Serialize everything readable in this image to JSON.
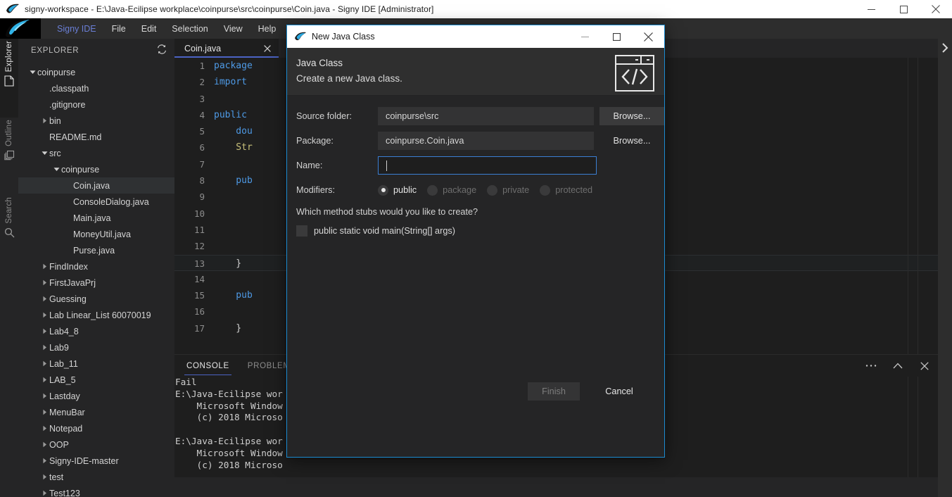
{
  "window": {
    "title": "signy-workspace - E:\\Java-Ecilipse workplace\\coinpurse\\src\\coinpurse\\Coin.java - Signy IDE [Administrator]",
    "app_icon": "signy-logo-icon",
    "minimize_icon": "minimize-icon",
    "maximize_icon": "maximize-icon",
    "close_icon": "close-icon"
  },
  "menubar": {
    "items": [
      {
        "label": "Signy IDE",
        "accent": true
      },
      {
        "label": "File",
        "accent": false
      },
      {
        "label": "Edit",
        "accent": false
      },
      {
        "label": "Selection",
        "accent": false
      },
      {
        "label": "View",
        "accent": false
      },
      {
        "label": "Help",
        "accent": false
      }
    ]
  },
  "activitybar": {
    "tabs": [
      {
        "label": "Explorer",
        "icon": "file-icon",
        "active": true
      },
      {
        "label": "Outline",
        "icon": "layers-icon",
        "active": false
      },
      {
        "label": "Search",
        "icon": "search-icon",
        "active": false
      }
    ]
  },
  "sidebar": {
    "title": "EXPLORER",
    "refresh_icon": "refresh-icon",
    "tree": [
      {
        "label": "coinpurse",
        "indent": 0,
        "twisty": "down",
        "selected": false
      },
      {
        "label": ".classpath",
        "indent": 1,
        "twisty": "none",
        "selected": false
      },
      {
        "label": ".gitignore",
        "indent": 1,
        "twisty": "none",
        "selected": false
      },
      {
        "label": "bin",
        "indent": 1,
        "twisty": "right",
        "selected": false
      },
      {
        "label": "README.md",
        "indent": 1,
        "twisty": "none",
        "selected": false
      },
      {
        "label": "src",
        "indent": 1,
        "twisty": "down",
        "selected": false
      },
      {
        "label": "coinpurse",
        "indent": 2,
        "twisty": "down",
        "selected": false
      },
      {
        "label": "Coin.java",
        "indent": 3,
        "twisty": "none",
        "selected": true
      },
      {
        "label": "ConsoleDialog.java",
        "indent": 3,
        "twisty": "none",
        "selected": false
      },
      {
        "label": "Main.java",
        "indent": 3,
        "twisty": "none",
        "selected": false
      },
      {
        "label": "MoneyUtil.java",
        "indent": 3,
        "twisty": "none",
        "selected": false
      },
      {
        "label": "Purse.java",
        "indent": 3,
        "twisty": "none",
        "selected": false
      },
      {
        "label": "FindIndex",
        "indent": 1,
        "twisty": "right",
        "selected": false
      },
      {
        "label": "FirstJavaPrj",
        "indent": 1,
        "twisty": "right",
        "selected": false
      },
      {
        "label": "Guessing",
        "indent": 1,
        "twisty": "right",
        "selected": false
      },
      {
        "label": "Lab Linear_List 60070019",
        "indent": 1,
        "twisty": "right",
        "selected": false
      },
      {
        "label": "Lab4_8",
        "indent": 1,
        "twisty": "right",
        "selected": false
      },
      {
        "label": "Lab9",
        "indent": 1,
        "twisty": "right",
        "selected": false
      },
      {
        "label": "Lab_11",
        "indent": 1,
        "twisty": "right",
        "selected": false
      },
      {
        "label": "LAB_5",
        "indent": 1,
        "twisty": "right",
        "selected": false
      },
      {
        "label": "Lastday",
        "indent": 1,
        "twisty": "right",
        "selected": false
      },
      {
        "label": "MenuBar",
        "indent": 1,
        "twisty": "right",
        "selected": false
      },
      {
        "label": "Notepad",
        "indent": 1,
        "twisty": "right",
        "selected": false
      },
      {
        "label": "OOP",
        "indent": 1,
        "twisty": "right",
        "selected": false
      },
      {
        "label": "Signy-IDE-master",
        "indent": 1,
        "twisty": "right",
        "selected": false
      },
      {
        "label": "test",
        "indent": 1,
        "twisty": "right",
        "selected": false
      },
      {
        "label": "Test123",
        "indent": 1,
        "twisty": "right",
        "selected": false
      }
    ]
  },
  "editor": {
    "tab": {
      "name": "Coin.java",
      "close_icon": "close-icon"
    },
    "current_line": 13,
    "lines": [
      {
        "n": 1,
        "tokens": [
          {
            "t": "package",
            "c": "kw"
          }
        ]
      },
      {
        "n": 2,
        "tokens": [
          {
            "t": "import",
            "c": "kw"
          }
        ]
      },
      {
        "n": 3,
        "tokens": []
      },
      {
        "n": 4,
        "tokens": [
          {
            "t": "public",
            "c": "kw"
          }
        ]
      },
      {
        "n": 5,
        "tokens": [
          {
            "t": "    dou",
            "c": "kw"
          }
        ]
      },
      {
        "n": 6,
        "tokens": [
          {
            "t": "    Str",
            "c": "ty"
          }
        ]
      },
      {
        "n": 7,
        "tokens": []
      },
      {
        "n": 8,
        "tokens": [
          {
            "t": "    pub",
            "c": "kw"
          }
        ]
      },
      {
        "n": 9,
        "tokens": []
      },
      {
        "n": 10,
        "tokens": []
      },
      {
        "n": 11,
        "tokens": []
      },
      {
        "n": 12,
        "tokens": []
      },
      {
        "n": 13,
        "tokens": [
          {
            "t": "    }",
            "c": "pl"
          }
        ]
      },
      {
        "n": 14,
        "tokens": []
      },
      {
        "n": 15,
        "tokens": [
          {
            "t": "    pub",
            "c": "kw"
          }
        ]
      },
      {
        "n": 16,
        "tokens": []
      },
      {
        "n": 17,
        "tokens": [
          {
            "t": "    }",
            "c": "pl"
          }
        ]
      }
    ]
  },
  "panel": {
    "tabs": [
      {
        "label": "CONSOLE",
        "active": true
      },
      {
        "label": "PROBLEMS",
        "active": false
      }
    ],
    "actions": [
      {
        "icon": "more-icon",
        "name": "panel-more-button"
      },
      {
        "icon": "chevron-up-icon",
        "name": "panel-maximize-button"
      },
      {
        "icon": "close-icon",
        "name": "panel-close-button"
      }
    ],
    "console_lines": [
      "Fail",
      "E:\\Java-Ecilipse wor",
      "    Microsoft Window",
      "    (c) 2018 Microso",
      "",
      "E:\\Java-Ecilipse wor",
      "    Microsoft Window",
      "    (c) 2018 Microso"
    ]
  },
  "right_rail": {
    "chevron_icon": "chevron-right-icon"
  },
  "dialog": {
    "titlebar": {
      "icon": "signy-logo-icon",
      "title": "New Java Class",
      "minimize_icon": "minimize-icon",
      "maximize_icon": "maximize-icon",
      "close_icon": "close-icon"
    },
    "header": {
      "heading": "Java Class",
      "subheading": "Create a new Java class.",
      "icon": "code-window-icon"
    },
    "fields": [
      {
        "label": "Source folder:",
        "value": "coinpurse\\src",
        "placeholder": "",
        "focused": false,
        "browse_label": "Browse...",
        "browse_boxed": true
      },
      {
        "label": "Package:",
        "value": "coinpurse.Coin.java",
        "placeholder": "",
        "focused": false,
        "browse_label": "Browse...",
        "browse_boxed": false
      },
      {
        "label": "Name:",
        "value": "",
        "placeholder": "",
        "focused": true,
        "browse_label": "",
        "browse_boxed": false
      }
    ],
    "modifiers": {
      "label": "Modifiers:",
      "options": [
        {
          "label": "public",
          "selected": true
        },
        {
          "label": "package",
          "selected": false
        },
        {
          "label": "private",
          "selected": false
        },
        {
          "label": "protected",
          "selected": false
        }
      ]
    },
    "stubs": {
      "question": "Which method stubs would you like to create?",
      "checkbox_label": "public static void main(String[] args)",
      "checked": false
    },
    "buttons": {
      "finish": {
        "label": "Finish",
        "enabled": false
      },
      "cancel": {
        "label": "Cancel",
        "enabled": true
      }
    }
  },
  "colors": {
    "accent_blue": "#1b8bd0",
    "tab_underline": "#4b63c4",
    "keyword": "#4e9ae6",
    "type": "#c8c07a",
    "editor_bg": "#1e1e1e",
    "panel_bg": "#252526"
  }
}
